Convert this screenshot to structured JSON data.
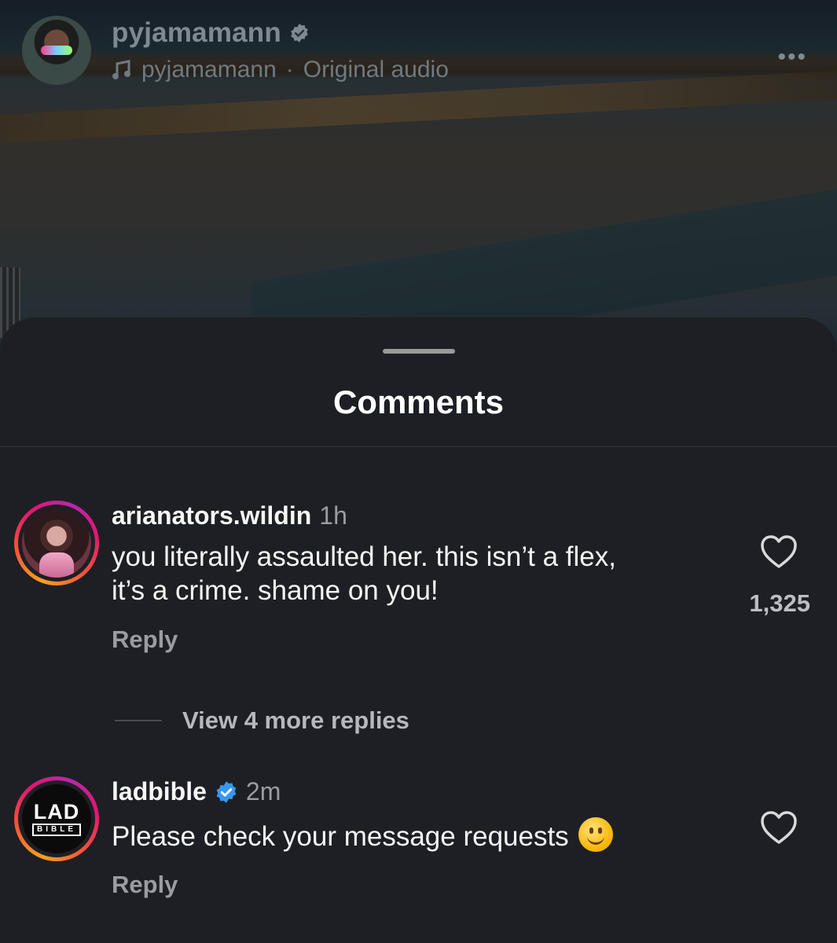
{
  "header": {
    "username": "pyjamamann",
    "verified_icon": "verified-badge-icon",
    "audio_username": "pyjamamann",
    "audio_separator": "·",
    "audio_label": "Original audio",
    "more_label": "•••"
  },
  "sheet": {
    "title": "Comments"
  },
  "comments": [
    {
      "username": "arianators.wildin",
      "time": "1h",
      "text_line1": "you literally assaulted her. this isn’t a flex,",
      "text_line2": "it’s a crime. shame on you!",
      "reply_label": "Reply",
      "like_count": "1,325",
      "view_more": "View 4 more replies"
    },
    {
      "username": "ladbible",
      "time": "2m",
      "text": "Please check your message requests",
      "emoji": "slightly-smiling-face",
      "avatar_logo_top": "LAD",
      "avatar_logo_bottom": "BIBLE",
      "reply_label": "Reply"
    }
  ],
  "colors": {
    "background": "#1e1f24",
    "verified_blue": "#3897f0",
    "story_ring": [
      "#f9a21b",
      "#e3166e",
      "#b429a8"
    ]
  }
}
